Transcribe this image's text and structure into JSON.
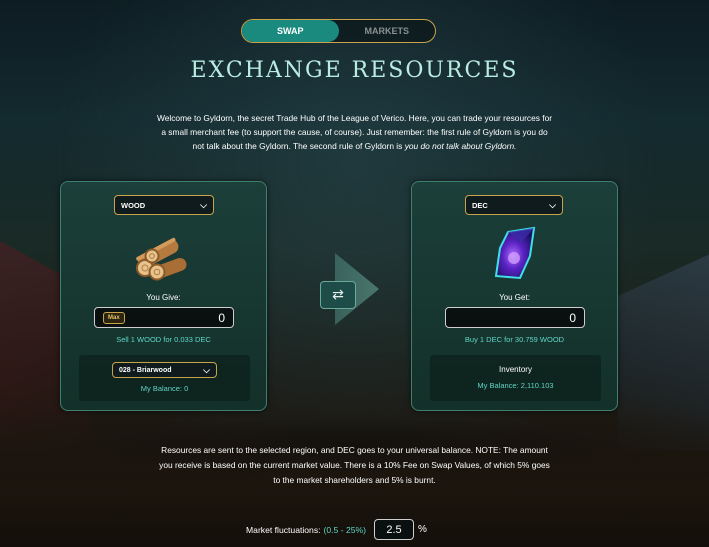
{
  "tabs": [
    {
      "label": "SWAP",
      "active": true
    },
    {
      "label": "MARKETS",
      "active": false
    }
  ],
  "title": "EXCHANGE RESOURCES",
  "intro": {
    "line1": "Welcome to Gyldorn, the secret Trade Hub of the League of Verico. Here, you can trade your resources for",
    "line2": "a small merchant fee (to support the cause, of course). Just remember: the first rule of Gyldorn is you do",
    "line3_start": "not talk about the Gyldorn. The second rule of Gyldorn is ",
    "line3_italic": "you do not talk about Gyldorn."
  },
  "give_panel": {
    "resource_select": "WOOD",
    "resource_icon": "wood-logs-icon",
    "label": "You Give:",
    "max_label": "Max",
    "amount": "0",
    "rate_text": "Sell 1 WOOD for 0.033 DEC",
    "region_select": "028 - Briarwood",
    "balance_text": "My Balance: 0"
  },
  "swap_button_icon": "swap-arrows-icon",
  "get_panel": {
    "resource_select": "DEC",
    "resource_icon": "dec-crystal-icon",
    "label": "You Get:",
    "amount": "0",
    "rate_text": "Buy 1 DEC for 30.759 WOOD",
    "inventory_label": "Inventory",
    "balance_text": "My Balance: 2,110.103"
  },
  "note": {
    "line1": "Resources are sent to the selected region, and DEC goes to your universal balance. NOTE: The amount",
    "line2": "you receive is based on the current market value. There is a 10% Fee on Swap Values, of which 5% goes",
    "line3": "to the market shareholders and 5% is burnt."
  },
  "fluctuation": {
    "label": "Market fluctuations:",
    "range": "(0.5 - 25%)",
    "value": "2.5",
    "unit": "%"
  },
  "colors": {
    "accent_teal": "#1a8a7e",
    "gold_border": "#c9a24a",
    "title_color": "#b9ece2",
    "link_teal": "#5fd6c7"
  }
}
